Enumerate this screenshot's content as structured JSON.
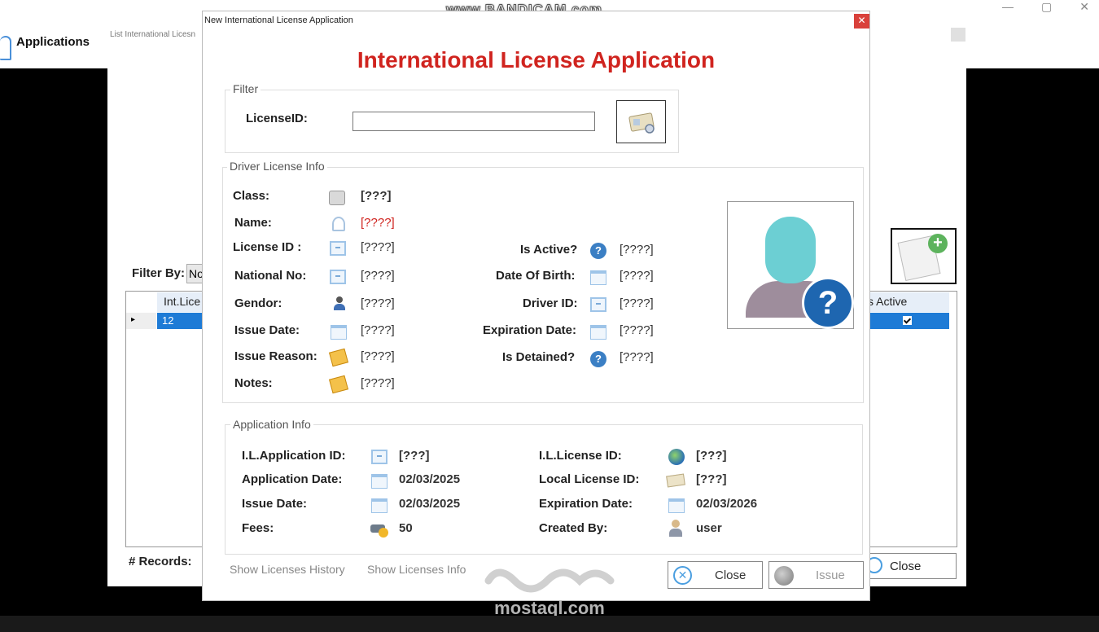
{
  "recorder_watermark": "www.BANDICAM.com",
  "app": {
    "nav_label": "Applications"
  },
  "window_controls": [
    "—",
    "▢",
    "✕"
  ],
  "background_window": {
    "title": "List International Licesn",
    "filter_by_label": "Filter By:",
    "filter_combo_value": "No",
    "grid": {
      "col1_header": "Int.Lice",
      "col1_value": "12",
      "col2_header": "s Active",
      "col2_checked": true
    },
    "records_label": "# Records:",
    "close_label": "Close"
  },
  "dialog": {
    "window_title": "New International License Application",
    "close_x": "✕",
    "heading": "International License Application",
    "filter_group": {
      "label": "Filter",
      "license_id_label": "LicenseID:",
      "license_id_value": ""
    },
    "driver_group": {
      "label": "Driver License Info",
      "class_label": "Class:",
      "class_value": "[???]",
      "name_label": "Name:",
      "name_value": "[????]",
      "license_id_label": "License ID :",
      "license_id_value": "[????]",
      "national_no_label": "National No:",
      "national_no_value": "[????]",
      "gendor_label": "Gendor:",
      "gendor_value": "[????]",
      "issue_date_label": "Issue Date:",
      "issue_date_value": "[????]",
      "issue_reason_label": "Issue Reason:",
      "issue_reason_value": "[????]",
      "notes_label": "Notes:",
      "notes_value": "[????]",
      "is_active_label": "Is Active?",
      "is_active_value": "[????]",
      "dob_label": "Date Of Birth:",
      "dob_value": "[????]",
      "driver_id_label": "Driver ID:",
      "driver_id_value": "[????]",
      "expiration_label": "Expiration Date:",
      "expiration_value": "[????]",
      "is_detained_label": "Is Detained?",
      "is_detained_value": "[????]"
    },
    "app_group": {
      "label": "Application Info",
      "il_app_id_label": "I.L.Application ID:",
      "il_app_id_value": "[???]",
      "app_date_label": "Application Date:",
      "app_date_value": "02/03/2025",
      "issue_date_label": "Issue Date:",
      "issue_date_value": "02/03/2025",
      "fees_label": "Fees:",
      "fees_value": "50",
      "il_license_id_label": "I.L.License ID:",
      "il_license_id_value": "[???]",
      "local_license_id_label": "Local License ID:",
      "local_license_id_value": "[???]",
      "expiration_label": "Expiration Date:",
      "expiration_value": "02/03/2026",
      "created_by_label": "Created By:",
      "created_by_value": "user"
    },
    "links": {
      "history": "Show Licenses History",
      "info": "Show Licenses Info"
    },
    "buttons": {
      "close": "Close",
      "issue": "Issue"
    }
  },
  "site_watermark": {
    "url": "mostaql.com"
  },
  "colors": {
    "heading_red": "#d0241f",
    "selection_blue": "#1e7bd6",
    "icon_blue": "#3b7fc4"
  }
}
